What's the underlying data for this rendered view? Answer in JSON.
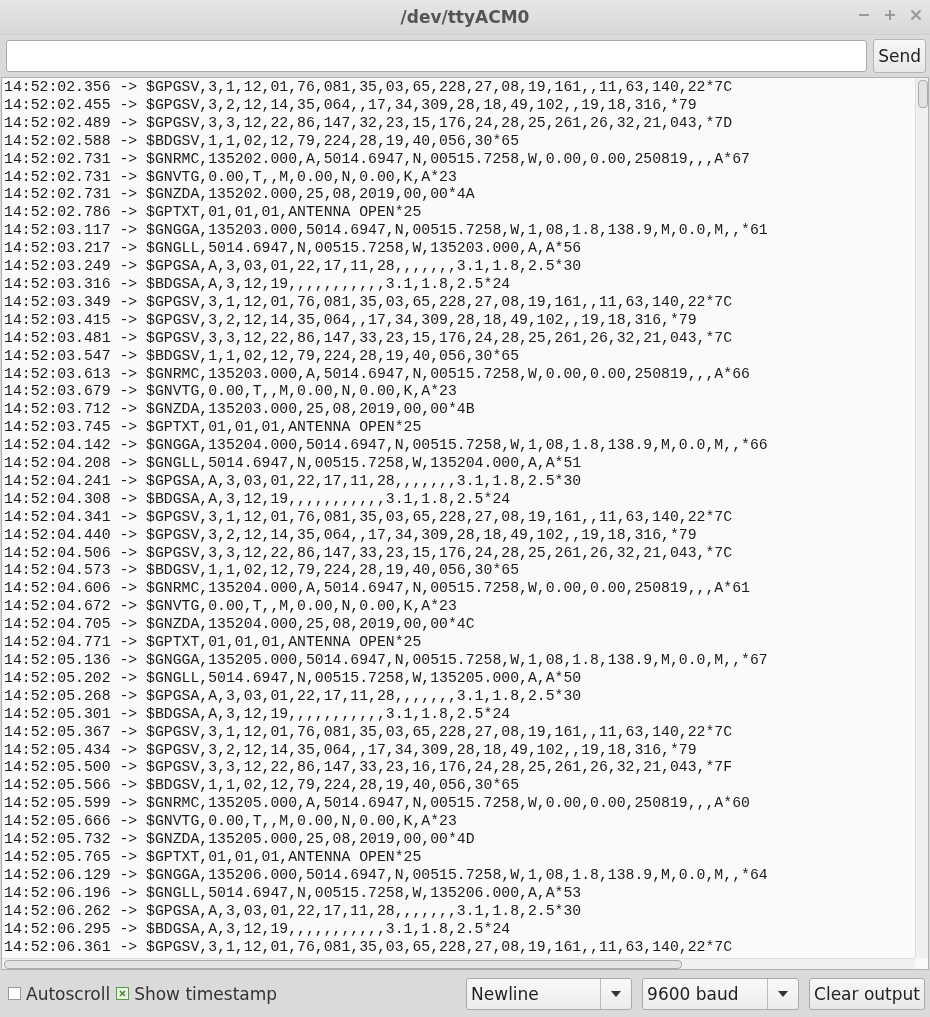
{
  "window": {
    "title": "/dev/ttyACM0"
  },
  "send_button": {
    "label": "Send"
  },
  "output_lines": [
    "14:52:02.356 -> $GPGSV,3,1,12,01,76,081,35,03,65,228,27,08,19,161,,11,63,140,22*7C",
    "14:52:02.455 -> $GPGSV,3,2,12,14,35,064,,17,34,309,28,18,49,102,,19,18,316,*79",
    "14:52:02.489 -> $GPGSV,3,3,12,22,86,147,32,23,15,176,24,28,25,261,26,32,21,043,*7D",
    "14:52:02.588 -> $BDGSV,1,1,02,12,79,224,28,19,40,056,30*65",
    "14:52:02.731 -> $GNRMC,135202.000,A,5014.6947,N,00515.7258,W,0.00,0.00,250819,,,A*67",
    "14:52:02.731 -> $GNVTG,0.00,T,,M,0.00,N,0.00,K,A*23",
    "14:52:02.731 -> $GNZDA,135202.000,25,08,2019,00,00*4A",
    "14:52:02.786 -> $GPTXT,01,01,01,ANTENNA OPEN*25",
    "14:52:03.117 -> $GNGGA,135203.000,5014.6947,N,00515.7258,W,1,08,1.8,138.9,M,0.0,M,,*61",
    "14:52:03.217 -> $GNGLL,5014.6947,N,00515.7258,W,135203.000,A,A*56",
    "14:52:03.249 -> $GPGSA,A,3,03,01,22,17,11,28,,,,,,,3.1,1.8,2.5*30",
    "14:52:03.316 -> $BDGSA,A,3,12,19,,,,,,,,,,,3.1,1.8,2.5*24",
    "14:52:03.349 -> $GPGSV,3,1,12,01,76,081,35,03,65,228,27,08,19,161,,11,63,140,22*7C",
    "14:52:03.415 -> $GPGSV,3,2,12,14,35,064,,17,34,309,28,18,49,102,,19,18,316,*79",
    "14:52:03.481 -> $GPGSV,3,3,12,22,86,147,33,23,15,176,24,28,25,261,26,32,21,043,*7C",
    "14:52:03.547 -> $BDGSV,1,1,02,12,79,224,28,19,40,056,30*65",
    "14:52:03.613 -> $GNRMC,135203.000,A,5014.6947,N,00515.7258,W,0.00,0.00,250819,,,A*66",
    "14:52:03.679 -> $GNVTG,0.00,T,,M,0.00,N,0.00,K,A*23",
    "14:52:03.712 -> $GNZDA,135203.000,25,08,2019,00,00*4B",
    "14:52:03.745 -> $GPTXT,01,01,01,ANTENNA OPEN*25",
    "14:52:04.142 -> $GNGGA,135204.000,5014.6947,N,00515.7258,W,1,08,1.8,138.9,M,0.0,M,,*66",
    "14:52:04.208 -> $GNGLL,5014.6947,N,00515.7258,W,135204.000,A,A*51",
    "14:52:04.241 -> $GPGSA,A,3,03,01,22,17,11,28,,,,,,,3.1,1.8,2.5*30",
    "14:52:04.308 -> $BDGSA,A,3,12,19,,,,,,,,,,,3.1,1.8,2.5*24",
    "14:52:04.341 -> $GPGSV,3,1,12,01,76,081,35,03,65,228,27,08,19,161,,11,63,140,22*7C",
    "14:52:04.440 -> $GPGSV,3,2,12,14,35,064,,17,34,309,28,18,49,102,,19,18,316,*79",
    "14:52:04.506 -> $GPGSV,3,3,12,22,86,147,33,23,15,176,24,28,25,261,26,32,21,043,*7C",
    "14:52:04.573 -> $BDGSV,1,1,02,12,79,224,28,19,40,056,30*65",
    "14:52:04.606 -> $GNRMC,135204.000,A,5014.6947,N,00515.7258,W,0.00,0.00,250819,,,A*61",
    "14:52:04.672 -> $GNVTG,0.00,T,,M,0.00,N,0.00,K,A*23",
    "14:52:04.705 -> $GNZDA,135204.000,25,08,2019,00,00*4C",
    "14:52:04.771 -> $GPTXT,01,01,01,ANTENNA OPEN*25",
    "14:52:05.136 -> $GNGGA,135205.000,5014.6947,N,00515.7258,W,1,08,1.8,138.9,M,0.0,M,,*67",
    "14:52:05.202 -> $GNGLL,5014.6947,N,00515.7258,W,135205.000,A,A*50",
    "14:52:05.268 -> $GPGSA,A,3,03,01,22,17,11,28,,,,,,,3.1,1.8,2.5*30",
    "14:52:05.301 -> $BDGSA,A,3,12,19,,,,,,,,,,,3.1,1.8,2.5*24",
    "14:52:05.367 -> $GPGSV,3,1,12,01,76,081,35,03,65,228,27,08,19,161,,11,63,140,22*7C",
    "14:52:05.434 -> $GPGSV,3,2,12,14,35,064,,17,34,309,28,18,49,102,,19,18,316,*79",
    "14:52:05.500 -> $GPGSV,3,3,12,22,86,147,33,23,16,176,24,28,25,261,26,32,21,043,*7F",
    "14:52:05.566 -> $BDGSV,1,1,02,12,79,224,28,19,40,056,30*65",
    "14:52:05.599 -> $GNRMC,135205.000,A,5014.6947,N,00515.7258,W,0.00,0.00,250819,,,A*60",
    "14:52:05.666 -> $GNVTG,0.00,T,,M,0.00,N,0.00,K,A*23",
    "14:52:05.732 -> $GNZDA,135205.000,25,08,2019,00,00*4D",
    "14:52:05.765 -> $GPTXT,01,01,01,ANTENNA OPEN*25",
    "14:52:06.129 -> $GNGGA,135206.000,5014.6947,N,00515.7258,W,1,08,1.8,138.9,M,0.0,M,,*64",
    "14:52:06.196 -> $GNGLL,5014.6947,N,00515.7258,W,135206.000,A,A*53",
    "14:52:06.262 -> $GPGSA,A,3,03,01,22,17,11,28,,,,,,,3.1,1.8,2.5*30",
    "14:52:06.295 -> $BDGSA,A,3,12,19,,,,,,,,,,,3.1,1.8,2.5*24",
    "14:52:06.361 -> $GPGSV,3,1,12,01,76,081,35,03,65,228,27,08,19,161,,11,63,140,22*7C"
  ],
  "options": [
    {
      "label": "Autoscroll",
      "checked": false
    },
    {
      "label": "Show timestamp",
      "checked": true
    }
  ],
  "line_ending": {
    "value": "Newline"
  },
  "baud_rate": {
    "value": "9600 baud"
  },
  "clear_button": {
    "label": "Clear output"
  }
}
